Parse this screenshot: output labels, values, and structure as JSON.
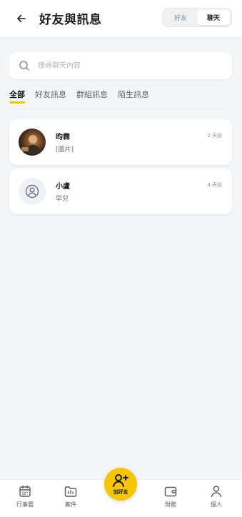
{
  "header": {
    "title": "好友與訊息",
    "segments": [
      {
        "label": "好友",
        "active": false
      },
      {
        "label": "聊天",
        "active": true
      }
    ]
  },
  "search": {
    "placeholder": "搜尋聊天內容",
    "value": ""
  },
  "filter_tabs": [
    {
      "label": "全部",
      "active": true
    },
    {
      "label": "好友訊息",
      "active": false
    },
    {
      "label": "群組訊息",
      "active": false
    },
    {
      "label": "陌生訊息",
      "active": false
    }
  ],
  "chats": [
    {
      "name": "昀霖",
      "preview": "[圖片]",
      "time": "2 天前",
      "avatar": "photo"
    },
    {
      "name": "小盧",
      "preview": "早兒",
      "time": "4 天前",
      "avatar": "default-user-icon"
    }
  ],
  "bottom_nav": {
    "items": [
      {
        "label": "行事曆",
        "icon": "calendar-icon"
      },
      {
        "label": "案件",
        "icon": "folder-icon"
      },
      {
        "label": "財務",
        "icon": "wallet-icon"
      },
      {
        "label": "個人",
        "icon": "person-icon"
      }
    ],
    "fab_label": "加好友",
    "fab_icon": "add-friend-icon"
  },
  "colors": {
    "accent": "#F7C600",
    "background": "#F4F5F7"
  }
}
